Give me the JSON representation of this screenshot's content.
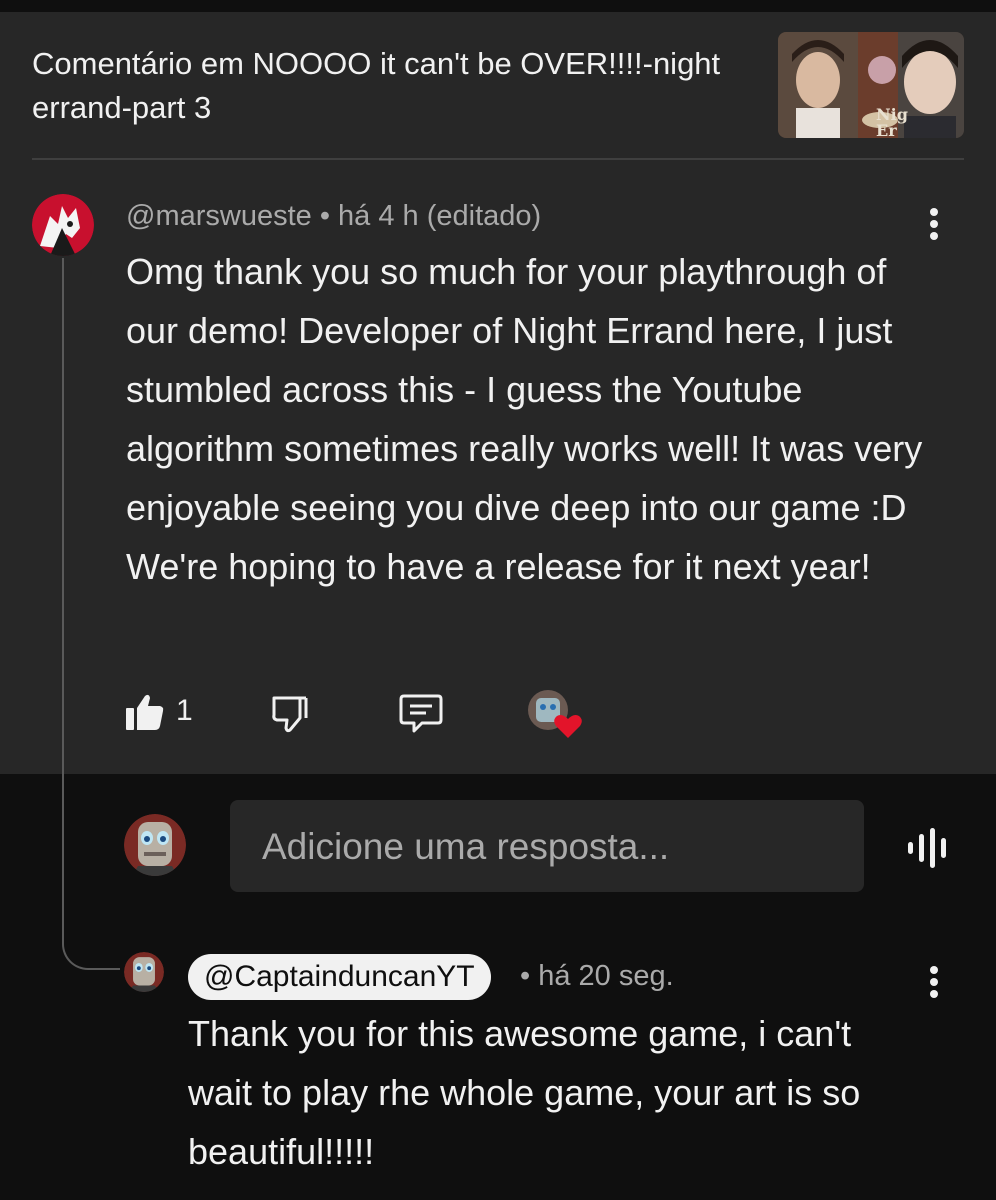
{
  "header": {
    "title": "Comentário em NOOOO it can't be OVER!!!!-night errand-part 3",
    "thumbnail_icon": "video-thumbnail"
  },
  "comment": {
    "author": "@marswueste",
    "meta": "• há 4 h (editado)",
    "text": "Omg thank you so much for your playthrough of our demo! Developer of Night Errand here, I just stumbled across this - I guess the Youtube algorithm sometimes really works well! It was very enjoyable seeing you dive deep into our game :D We're hoping to have a release for it next year!",
    "like_count": "1",
    "icons": [
      "thumbs-up-icon",
      "thumbs-down-icon",
      "reply-icon",
      "creator-heart-icon"
    ]
  },
  "reply_box": {
    "placeholder": "Adicione uma resposta...",
    "mic_icon": "voice-search-icon"
  },
  "reply": {
    "mention": "@CaptainduncanYT",
    "meta": "• há 20 seg.",
    "text": "Thank you for this awesome game, i can't wait to play rhe whole game, your art is so beautiful!!!!!"
  },
  "colors": {
    "background": "#0f0f0f",
    "panel": "#272727",
    "text": "#f1f1f1",
    "secondary_text": "#aaaaaa",
    "heart": "#e3142a"
  }
}
